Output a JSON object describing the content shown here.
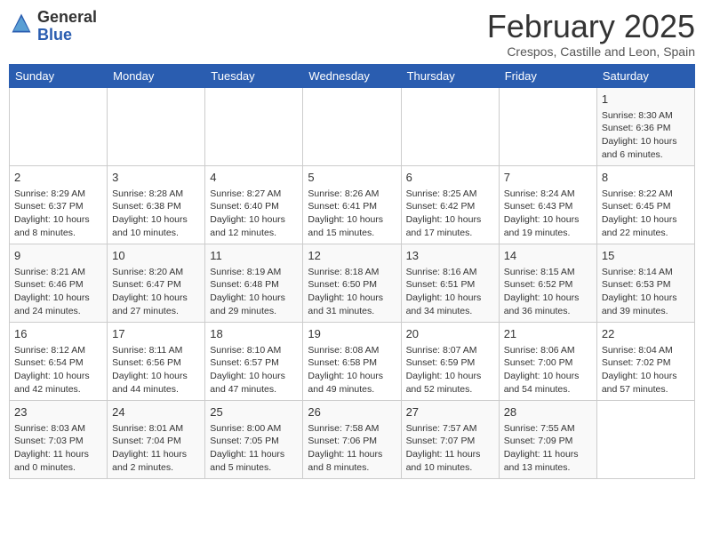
{
  "header": {
    "logo_general": "General",
    "logo_blue": "Blue",
    "month": "February 2025",
    "location": "Crespos, Castille and Leon, Spain"
  },
  "weekdays": [
    "Sunday",
    "Monday",
    "Tuesday",
    "Wednesday",
    "Thursday",
    "Friday",
    "Saturday"
  ],
  "weeks": [
    [
      {
        "day": "",
        "info": ""
      },
      {
        "day": "",
        "info": ""
      },
      {
        "day": "",
        "info": ""
      },
      {
        "day": "",
        "info": ""
      },
      {
        "day": "",
        "info": ""
      },
      {
        "day": "",
        "info": ""
      },
      {
        "day": "1",
        "info": "Sunrise: 8:30 AM\nSunset: 6:36 PM\nDaylight: 10 hours and 6 minutes."
      }
    ],
    [
      {
        "day": "2",
        "info": "Sunrise: 8:29 AM\nSunset: 6:37 PM\nDaylight: 10 hours and 8 minutes."
      },
      {
        "day": "3",
        "info": "Sunrise: 8:28 AM\nSunset: 6:38 PM\nDaylight: 10 hours and 10 minutes."
      },
      {
        "day": "4",
        "info": "Sunrise: 8:27 AM\nSunset: 6:40 PM\nDaylight: 10 hours and 12 minutes."
      },
      {
        "day": "5",
        "info": "Sunrise: 8:26 AM\nSunset: 6:41 PM\nDaylight: 10 hours and 15 minutes."
      },
      {
        "day": "6",
        "info": "Sunrise: 8:25 AM\nSunset: 6:42 PM\nDaylight: 10 hours and 17 minutes."
      },
      {
        "day": "7",
        "info": "Sunrise: 8:24 AM\nSunset: 6:43 PM\nDaylight: 10 hours and 19 minutes."
      },
      {
        "day": "8",
        "info": "Sunrise: 8:22 AM\nSunset: 6:45 PM\nDaylight: 10 hours and 22 minutes."
      }
    ],
    [
      {
        "day": "9",
        "info": "Sunrise: 8:21 AM\nSunset: 6:46 PM\nDaylight: 10 hours and 24 minutes."
      },
      {
        "day": "10",
        "info": "Sunrise: 8:20 AM\nSunset: 6:47 PM\nDaylight: 10 hours and 27 minutes."
      },
      {
        "day": "11",
        "info": "Sunrise: 8:19 AM\nSunset: 6:48 PM\nDaylight: 10 hours and 29 minutes."
      },
      {
        "day": "12",
        "info": "Sunrise: 8:18 AM\nSunset: 6:50 PM\nDaylight: 10 hours and 31 minutes."
      },
      {
        "day": "13",
        "info": "Sunrise: 8:16 AM\nSunset: 6:51 PM\nDaylight: 10 hours and 34 minutes."
      },
      {
        "day": "14",
        "info": "Sunrise: 8:15 AM\nSunset: 6:52 PM\nDaylight: 10 hours and 36 minutes."
      },
      {
        "day": "15",
        "info": "Sunrise: 8:14 AM\nSunset: 6:53 PM\nDaylight: 10 hours and 39 minutes."
      }
    ],
    [
      {
        "day": "16",
        "info": "Sunrise: 8:12 AM\nSunset: 6:54 PM\nDaylight: 10 hours and 42 minutes."
      },
      {
        "day": "17",
        "info": "Sunrise: 8:11 AM\nSunset: 6:56 PM\nDaylight: 10 hours and 44 minutes."
      },
      {
        "day": "18",
        "info": "Sunrise: 8:10 AM\nSunset: 6:57 PM\nDaylight: 10 hours and 47 minutes."
      },
      {
        "day": "19",
        "info": "Sunrise: 8:08 AM\nSunset: 6:58 PM\nDaylight: 10 hours and 49 minutes."
      },
      {
        "day": "20",
        "info": "Sunrise: 8:07 AM\nSunset: 6:59 PM\nDaylight: 10 hours and 52 minutes."
      },
      {
        "day": "21",
        "info": "Sunrise: 8:06 AM\nSunset: 7:00 PM\nDaylight: 10 hours and 54 minutes."
      },
      {
        "day": "22",
        "info": "Sunrise: 8:04 AM\nSunset: 7:02 PM\nDaylight: 10 hours and 57 minutes."
      }
    ],
    [
      {
        "day": "23",
        "info": "Sunrise: 8:03 AM\nSunset: 7:03 PM\nDaylight: 11 hours and 0 minutes."
      },
      {
        "day": "24",
        "info": "Sunrise: 8:01 AM\nSunset: 7:04 PM\nDaylight: 11 hours and 2 minutes."
      },
      {
        "day": "25",
        "info": "Sunrise: 8:00 AM\nSunset: 7:05 PM\nDaylight: 11 hours and 5 minutes."
      },
      {
        "day": "26",
        "info": "Sunrise: 7:58 AM\nSunset: 7:06 PM\nDaylight: 11 hours and 8 minutes."
      },
      {
        "day": "27",
        "info": "Sunrise: 7:57 AM\nSunset: 7:07 PM\nDaylight: 11 hours and 10 minutes."
      },
      {
        "day": "28",
        "info": "Sunrise: 7:55 AM\nSunset: 7:09 PM\nDaylight: 11 hours and 13 minutes."
      },
      {
        "day": "",
        "info": ""
      }
    ]
  ]
}
